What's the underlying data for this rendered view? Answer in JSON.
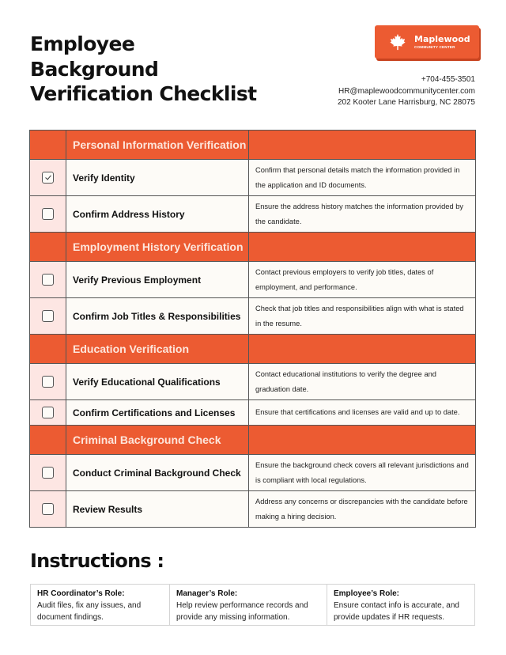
{
  "header": {
    "title_lines": [
      "Employee",
      "Background",
      "Verification Checklist"
    ]
  },
  "brand": {
    "icon": "maple-leaf-icon",
    "name": "Maplewood",
    "subtitle": "COMMUNITY CENTER",
    "color": "#ec5b32"
  },
  "contact": {
    "phone": "+704-455-3501",
    "email": "HR@maplewoodcommunitycenter.com",
    "address": "202 Kooter Lane Harrisburg, NC 28075"
  },
  "checklist": {
    "sections": [
      {
        "title": "Personal Information Verification",
        "items": [
          {
            "task": "Verify Identity",
            "checked": true,
            "description": "Confirm that personal details match the information provided in the application and ID documents."
          },
          {
            "task": "Confirm Address History",
            "checked": false,
            "description": "Ensure the address history matches the information provided by the candidate."
          }
        ]
      },
      {
        "title": "Employment History Verification",
        "items": [
          {
            "task": "Verify Previous Employment",
            "checked": false,
            "description": "Contact previous employers to verify job titles, dates of employment, and performance."
          },
          {
            "task": "Confirm Job Titles & Responsibilities",
            "checked": false,
            "description": "Check that job titles and responsibilities align with what is stated in the resume."
          }
        ]
      },
      {
        "title": "Education Verification",
        "items": [
          {
            "task": "Verify Educational Qualifications",
            "checked": false,
            "description": "Contact educational institutions to verify the degree and graduation date."
          },
          {
            "task": "Confirm Certifications and Licenses",
            "checked": false,
            "description": "Ensure that certifications and licenses are valid and up to date."
          }
        ]
      },
      {
        "title": "Criminal Background Check",
        "items": [
          {
            "task": "Conduct Criminal Background Check",
            "checked": false,
            "description": "Ensure the background check covers all relevant jurisdictions and is compliant with local regulations."
          },
          {
            "task": "Review Results",
            "checked": false,
            "description": "Address any concerns or discrepancies with the candidate before making a hiring decision."
          }
        ]
      }
    ]
  },
  "instructions": {
    "title": "Instructions :",
    "roles": [
      {
        "title": "HR Coordinator’s Role:",
        "text": "Audit files, fix any issues, and document findings."
      },
      {
        "title": "Manager’s Role:",
        "text": "Help review performance records and provide any missing information."
      },
      {
        "title": "Employee’s Role:",
        "text": "Ensure contact info is accurate, and provide updates if HR requests."
      }
    ]
  }
}
